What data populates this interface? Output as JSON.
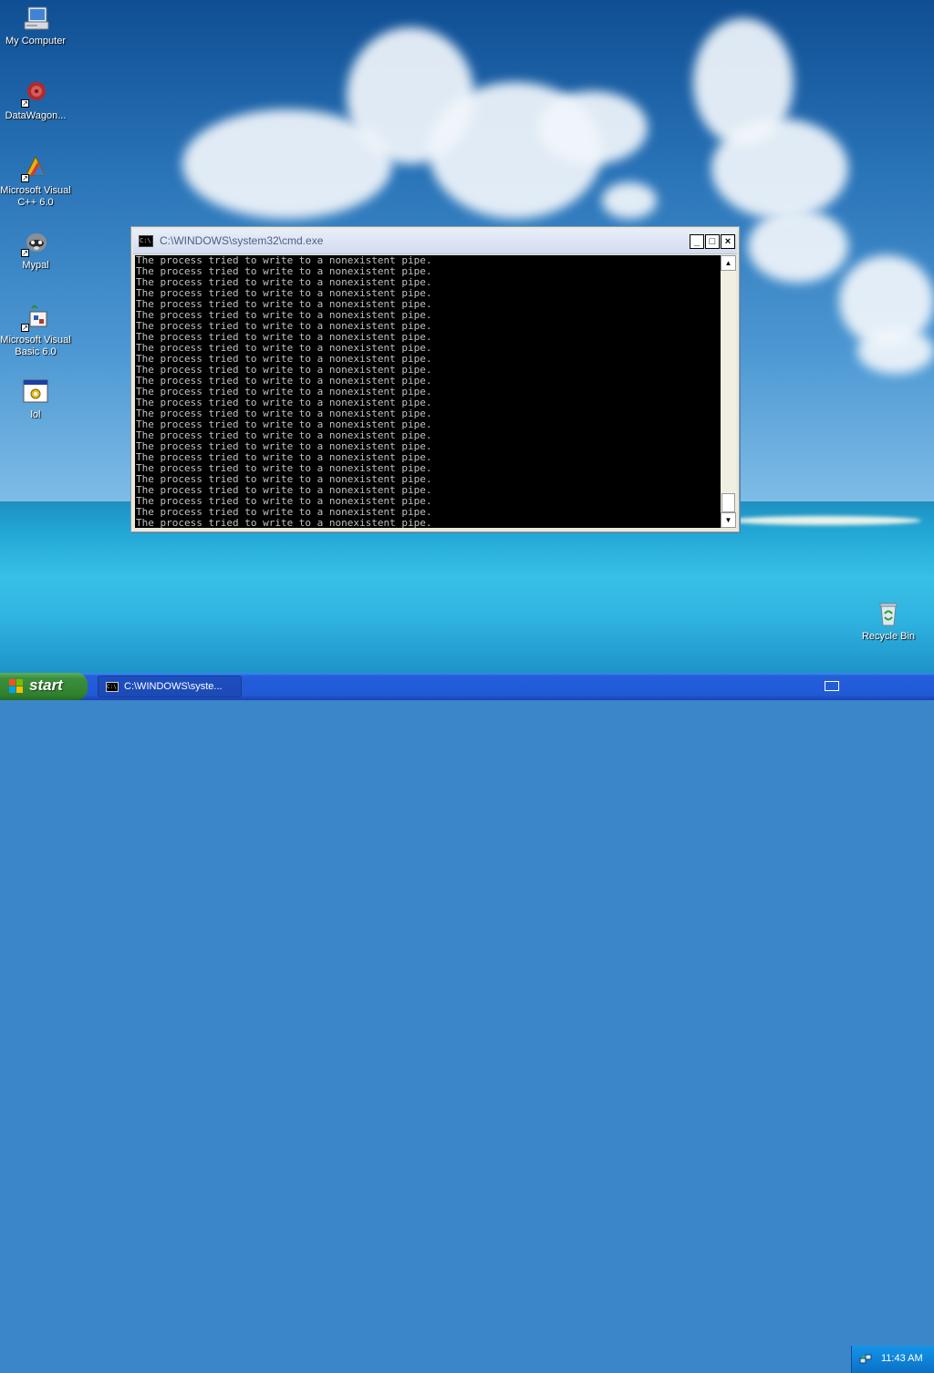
{
  "desktop": {
    "icons": [
      {
        "label": "My Computer",
        "icon": "computer-icon"
      },
      {
        "label": "DataWagon...",
        "icon": "datawagon-icon"
      },
      {
        "label_line1": "Microsoft Visual",
        "label_line2": "C++ 6.0",
        "icon": "visual-cpp-icon"
      },
      {
        "label": "Mypal",
        "icon": "mypal-icon"
      },
      {
        "label_line1": "Microsoft Visual",
        "label_line2": "Basic 6.0",
        "icon": "visual-basic-icon"
      },
      {
        "label": "lol",
        "icon": "executable-icon"
      }
    ],
    "recycle_bin": {
      "label": "Recycle Bin",
      "icon": "recycle-bin-icon"
    }
  },
  "cmd_window": {
    "title": "C:\\WINDOWS\\system32\\cmd.exe",
    "controls": {
      "minimize": "_",
      "maximize": "□",
      "close": "×"
    },
    "output_lines": [
      "The process tried to write to a nonexistent pipe.",
      "The process tried to write to a nonexistent pipe.",
      "The process tried to write to a nonexistent pipe.",
      "The process tried to write to a nonexistent pipe.",
      "The process tried to write to a nonexistent pipe.",
      "The process tried to write to a nonexistent pipe.",
      "The process tried to write to a nonexistent pipe.",
      "The process tried to write to a nonexistent pipe.",
      "The process tried to write to a nonexistent pipe.",
      "The process tried to write to a nonexistent pipe.",
      "The process tried to write to a nonexistent pipe.",
      "The process tried to write to a nonexistent pipe.",
      "The process tried to write to a nonexistent pipe.",
      "The process tried to write to a nonexistent pipe.",
      "The process tried to write to a nonexistent pipe.",
      "The process tried to write to a nonexistent pipe.",
      "The process tried to write to a nonexistent pipe.",
      "The process tried to write to a nonexistent pipe.",
      "The process tried to write to a nonexistent pipe.",
      "The process tried to write to a nonexistent pipe.",
      "The process tried to write to a nonexistent pipe.",
      "The process tried to write to a nonexistent pipe.",
      "The process tried to write to a nonexistent pipe.",
      "The process tried to write to a nonexistent pipe.",
      "The process tried to write to a nonexistent pipe."
    ],
    "scroll_position": 1.0
  },
  "taskbar": {
    "start_label": "start",
    "tasks": [
      {
        "label": "C:\\WINDOWS\\syste...",
        "icon": "cmd-icon"
      }
    ],
    "clock": "11:43 AM",
    "tray_icons": [
      "keyboard-icon",
      "network-icon"
    ]
  },
  "colors": {
    "taskbar_blue": "#245edb",
    "start_green": "#3c8f3c",
    "console_bg": "#000000",
    "console_text": "#c0c0c0"
  }
}
